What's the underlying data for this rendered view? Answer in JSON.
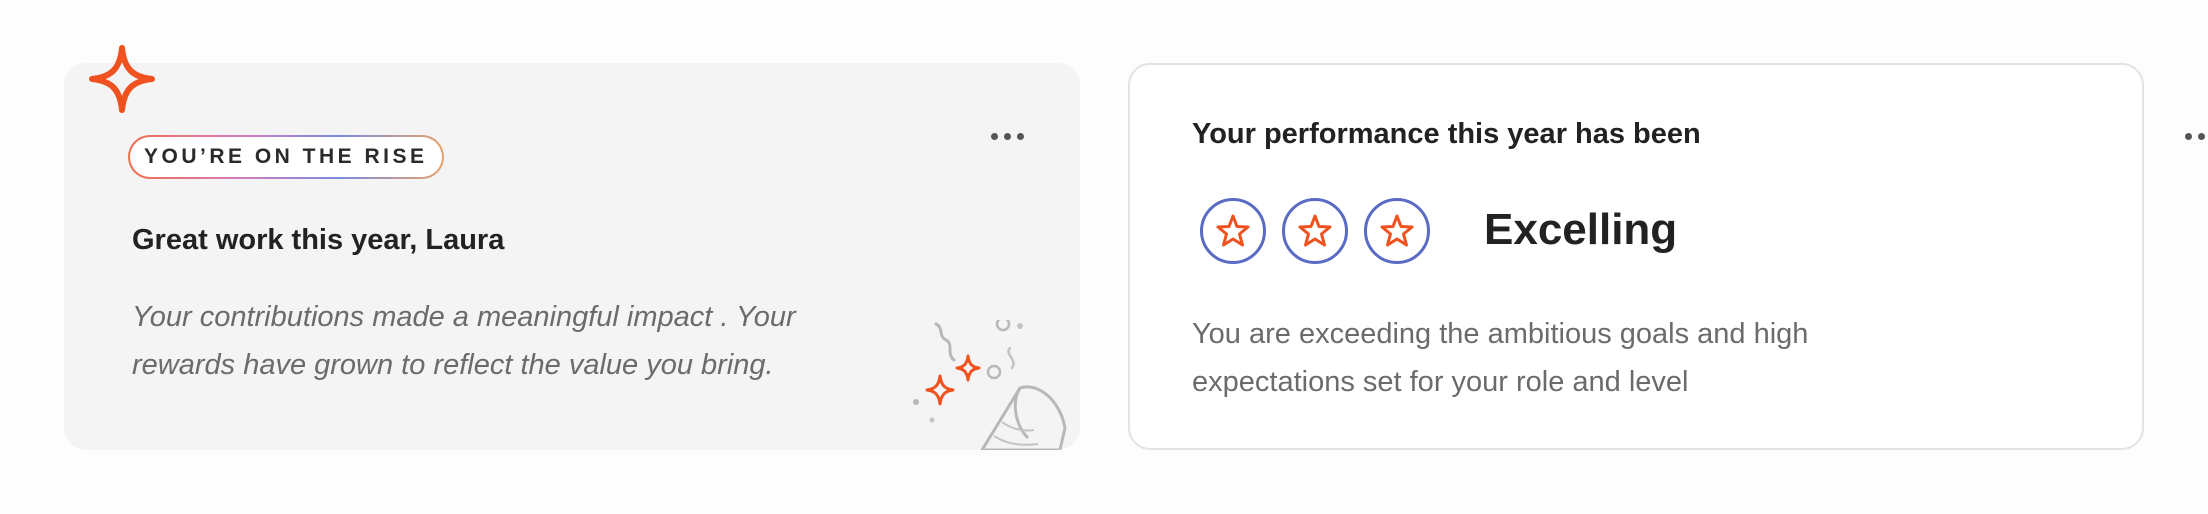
{
  "rise_card": {
    "badge": "YOU’RE ON THE RISE",
    "title": "Great work this year, Laura",
    "body": "Your contributions made a meaningful impact . Your rewards have grown to reflect the value you bring.",
    "corner_icon": "sparkle-icon",
    "decoration_icon": "party-popper-icon"
  },
  "performance_card": {
    "title": "Your performance this year has been",
    "rating": {
      "stars_filled": 3,
      "stars_total": 3,
      "label": "Excelling"
    },
    "body": "You are exceeding the ambitious goals and high expectations set for your role and level"
  },
  "colors": {
    "accent_orange": "#f0521f",
    "star_ring_blue": "#5a6bc4",
    "left_card_bg": "#f4f4f4"
  }
}
